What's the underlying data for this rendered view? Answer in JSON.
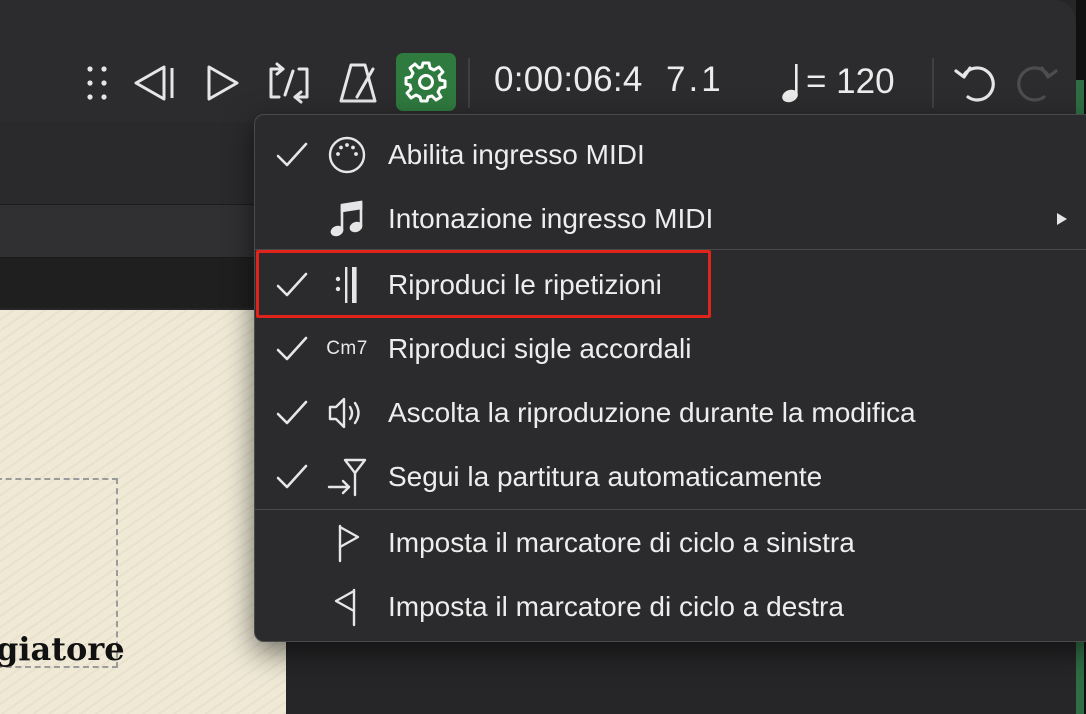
{
  "toolbar": {
    "time": "0:00:06:4",
    "measure": "7.1",
    "tempo_eq": "= 120",
    "icons": [
      "drag-handle-icon",
      "rewind-icon",
      "play-icon",
      "loop-icon",
      "metronome-icon",
      "gear-icon",
      "undo-icon",
      "redo-icon"
    ],
    "accent_color": "#2f7a3f"
  },
  "menu": {
    "items": [
      {
        "label": "Abilita ingresso MIDI",
        "checked": true,
        "icon": "midi-port-icon"
      },
      {
        "label": "Intonazione ingresso MIDI",
        "checked": false,
        "icon": "music-note-icon",
        "submenu": true
      },
      {
        "label": "Riproduci le ripetizioni",
        "checked": true,
        "icon": "repeat-barline-icon"
      },
      {
        "label": "Riproduci sigle accordali",
        "checked": true,
        "icon": "chord-symbol-icon",
        "icon_text": "Cm7"
      },
      {
        "label": "Ascolta la riproduzione durante la modifica",
        "checked": true,
        "icon": "speaker-icon"
      },
      {
        "label": "Segui la partitura automaticamente",
        "checked": true,
        "icon": "follow-score-icon"
      },
      {
        "label": "Imposta il marcatore di ciclo a sinistra",
        "checked": false,
        "icon": "left-loop-marker-icon"
      },
      {
        "label": "Imposta il marcatore di ciclo a destra",
        "checked": false,
        "icon": "right-loop-marker-icon"
      }
    ],
    "highlight_color": "#e0241c"
  },
  "score": {
    "visible_text": "giatore"
  }
}
